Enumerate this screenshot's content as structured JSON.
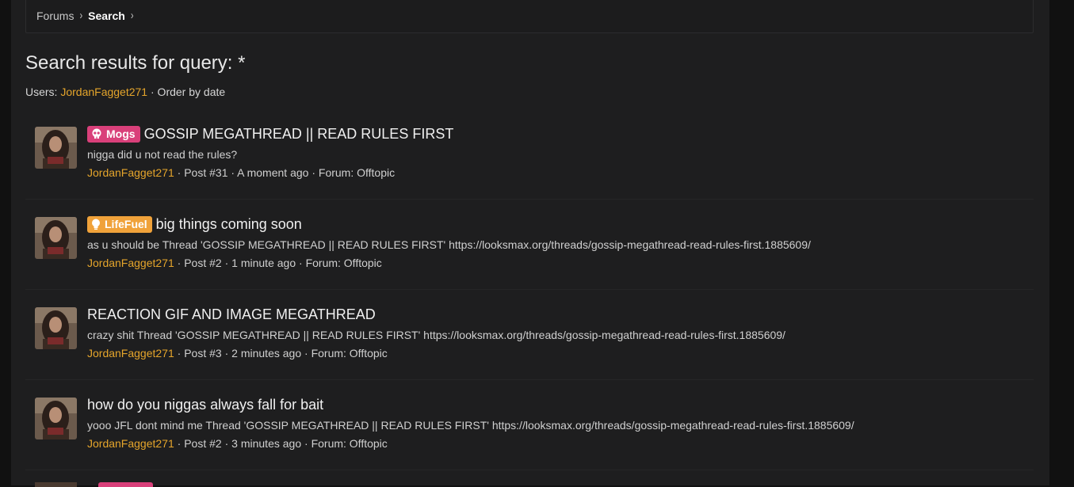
{
  "breadcrumb": {
    "items": [
      "Forums",
      "Search"
    ]
  },
  "heading": {
    "title": "Search results for query:  *"
  },
  "filters": {
    "users_label": "Users: ",
    "user": "JordanFagget271",
    "order": " · Order by date"
  },
  "results": [
    {
      "badge": "Mogs",
      "badge_icon": "skull-icon",
      "badge_color": "#d9407a",
      "title": "GOSSIP MEGATHREAD || READ RULES FIRST",
      "snippet": "nigga did u not read the rules?",
      "author": "JordanFagget271",
      "post": "Post #31",
      "time": "A moment ago",
      "forum": "Forum: Offtopic"
    },
    {
      "badge": "LifeFuel",
      "badge_icon": "lightbulb-icon",
      "badge_color": "#f0a23a",
      "title": "big things coming soon",
      "snippet": "as u should be Thread 'GOSSIP MEGATHREAD || READ RULES FIRST' https://looksmax.org/threads/gossip-megathread-read-rules-first.1885609/",
      "author": "JordanFagget271",
      "post": "Post #2",
      "time": "1 minute ago",
      "forum": "Forum: Offtopic"
    },
    {
      "badge": "",
      "title": "REACTION GIF AND IMAGE MEGATHREAD",
      "snippet": "crazy shit Thread 'GOSSIP MEGATHREAD || READ RULES FIRST' https://looksmax.org/threads/gossip-megathread-read-rules-first.1885609/",
      "author": "JordanFagget271",
      "post": "Post #3",
      "time": "2 minutes ago",
      "forum": "Forum: Offtopic"
    },
    {
      "badge": "",
      "title": "how do you niggas always fall for bait",
      "snippet": "yooo JFL dont mind me Thread 'GOSSIP MEGATHREAD || READ RULES FIRST' https://looksmax.org/threads/gossip-megathread-read-rules-first.1885609/",
      "author": "JordanFagget271",
      "post": "Post #2",
      "time": "3 minutes ago",
      "forum": "Forum: Offtopic"
    }
  ],
  "colors": {
    "link": "#e5a52b",
    "background": "#1e1e1f"
  }
}
